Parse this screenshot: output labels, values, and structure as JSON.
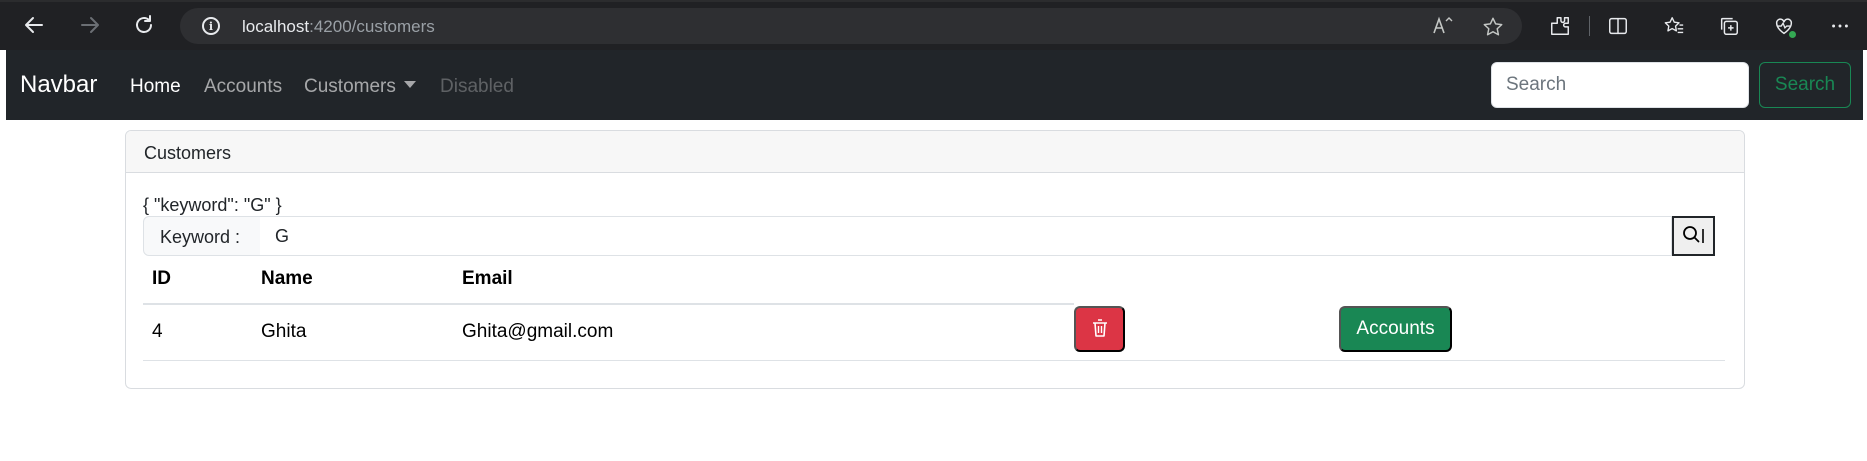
{
  "browser": {
    "url_host": "localhost",
    "url_path": ":4200/customers"
  },
  "navbar": {
    "brand": "Navbar",
    "links": [
      {
        "label": "Home"
      },
      {
        "label": "Accounts"
      },
      {
        "label": "Customers"
      },
      {
        "label": "Disabled"
      }
    ],
    "search_placeholder": "Search",
    "search_button": "Search"
  },
  "card": {
    "title": "Customers",
    "json_preview": "{ \"keyword\": \"G\" }",
    "keyword_label": "Keyword :",
    "keyword_value": "G"
  },
  "table": {
    "headers": [
      "ID",
      "Name",
      "Email"
    ],
    "rows": [
      {
        "id": "4",
        "name": "Ghita",
        "email": "Ghita@gmail.com",
        "action_label": "Accounts"
      }
    ]
  },
  "colors": {
    "navbar_bg": "#212529",
    "success": "#198754",
    "danger": "#dc3545"
  },
  "icons": {
    "delete": "trash-icon",
    "search": "search-icon"
  }
}
